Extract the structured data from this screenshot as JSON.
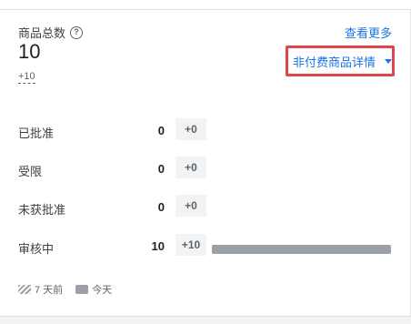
{
  "header": {
    "title": "商品总数",
    "help_icon": "question-circle-icon",
    "total": "10",
    "delta": "+10",
    "more_link": "查看更多",
    "dropdown_label": "非付费商品详情"
  },
  "rows": [
    {
      "label": "已批准",
      "count": "0",
      "delta": "+0",
      "bar_fraction": 0
    },
    {
      "label": "受限",
      "count": "0",
      "delta": "+0",
      "bar_fraction": 0
    },
    {
      "label": "未获批准",
      "count": "0",
      "delta": "+0",
      "bar_fraction": 0
    },
    {
      "label": "审核中",
      "count": "10",
      "delta": "+10",
      "bar_fraction": 1
    }
  ],
  "legend": {
    "previous_label": "7 天前",
    "today_label": "今天"
  },
  "colors": {
    "link": "#1a73e8",
    "highlight": "#e0474c",
    "bar": "#9aa0a6"
  }
}
